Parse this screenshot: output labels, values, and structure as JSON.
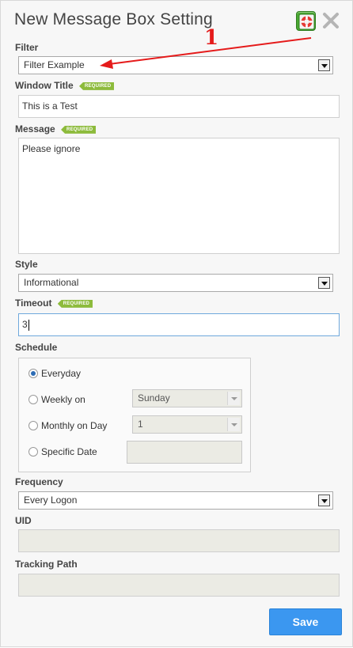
{
  "dialog": {
    "title": "New Message Box Setting"
  },
  "annotation": {
    "number": "1"
  },
  "filter": {
    "label": "Filter",
    "value": "Filter Example"
  },
  "window_title": {
    "label": "Window Title",
    "badge": "REQUIRED",
    "value": "This is a Test"
  },
  "message": {
    "label": "Message",
    "badge": "REQUIRED",
    "value": "Please ignore"
  },
  "style": {
    "label": "Style",
    "value": "Informational"
  },
  "timeout": {
    "label": "Timeout",
    "badge": "REQUIRED",
    "value": "3"
  },
  "schedule": {
    "label": "Schedule",
    "options": [
      {
        "label": "Everyday",
        "checked": true
      },
      {
        "label": "Weekly on",
        "checked": false,
        "select_value": "Sunday"
      },
      {
        "label": "Monthly on Day",
        "checked": false,
        "select_value": "1"
      },
      {
        "label": "Specific Date",
        "checked": false
      }
    ]
  },
  "frequency": {
    "label": "Frequency",
    "value": "Every Logon"
  },
  "uid": {
    "label": "UID",
    "value": ""
  },
  "tracking_path": {
    "label": "Tracking Path",
    "value": ""
  },
  "save": {
    "label": "Save"
  },
  "icons": {
    "help": "lifebuoy-help-icon",
    "close": "close-icon"
  },
  "colors": {
    "accent": "#3b97f0",
    "required_badge": "#8dbb3c",
    "annotation": "#e51b1b",
    "help_icon": "#4aa832"
  }
}
